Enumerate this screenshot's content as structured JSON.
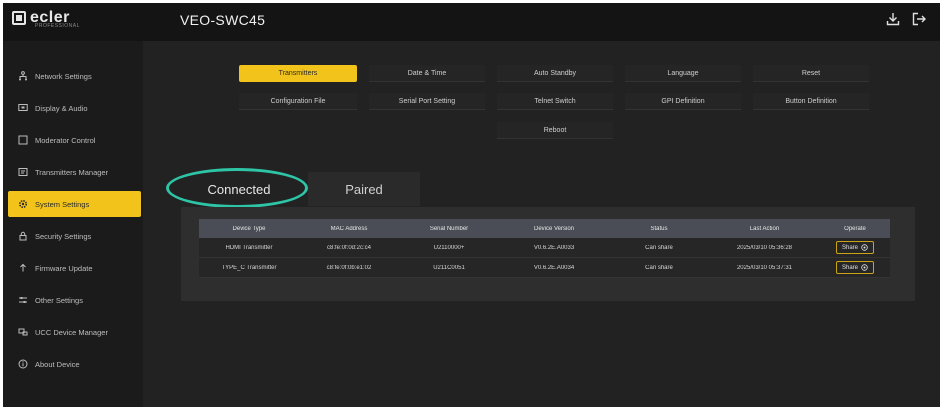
{
  "app": {
    "brand": "ecler",
    "brand_sub": "PROFESSIONAL",
    "device_title": "VEO-SWC45"
  },
  "topbar": {
    "icons": [
      "download-icon",
      "logout-icon"
    ]
  },
  "sidebar": {
    "items": [
      {
        "label": "Network Settings",
        "icon": "network-icon",
        "active": false
      },
      {
        "label": "Display & Audio",
        "icon": "display-icon",
        "active": false
      },
      {
        "label": "Moderator Control",
        "icon": "moderator-icon",
        "active": false
      },
      {
        "label": "Transmitters Manager",
        "icon": "transmitter-icon",
        "active": false
      },
      {
        "label": "System Settings",
        "icon": "gear-icon",
        "active": true
      },
      {
        "label": "Security Settings",
        "icon": "lock-icon",
        "active": false
      },
      {
        "label": "Firmware Update",
        "icon": "upload-icon",
        "active": false
      },
      {
        "label": "Other Settings",
        "icon": "sliders-icon",
        "active": false
      },
      {
        "label": "UCC Device Manager",
        "icon": "ucc-icon",
        "active": false
      },
      {
        "label": "About Device",
        "icon": "info-icon",
        "active": false
      }
    ]
  },
  "settings_tabs": {
    "row1": [
      "Transmitters",
      "Date & Time",
      "Auto Standby",
      "Language",
      "Reset"
    ],
    "row2": [
      "Configuration File",
      "Serial Port Setting",
      "Telnet Switch",
      "GPI Definition",
      "Button Definition"
    ],
    "row3": [
      "Reboot"
    ],
    "active": "Transmitters"
  },
  "connection_tabs": {
    "connected": "Connected",
    "paired": "Paired",
    "active": "Connected"
  },
  "table": {
    "headers": [
      "Device Type",
      "MAC Address",
      "Serial Number",
      "Device Version",
      "Status",
      "Last Action",
      "Operate"
    ],
    "rows": [
      {
        "device_type": "HDMI Transmitter",
        "mac": "c8:fe:0f:0d:2c:c4",
        "serial": "U2110000+",
        "version": "V0.6.2E.A0033",
        "status": "Can share",
        "last_action": "2025/03/10 05:36:28",
        "operate": "Share"
      },
      {
        "device_type": "TYPE_C Transmitter",
        "mac": "c8:fe:0f:0b:e1:02",
        "serial": "U211C0051",
        "version": "V0.6.2E.A0034",
        "status": "Can share",
        "last_action": "2025/03/10 05:37:31",
        "operate": "Share"
      }
    ]
  },
  "colors": {
    "accent": "#f2c41b",
    "highlight_ring": "#2ec4a6",
    "background": "#1d1d1d"
  }
}
